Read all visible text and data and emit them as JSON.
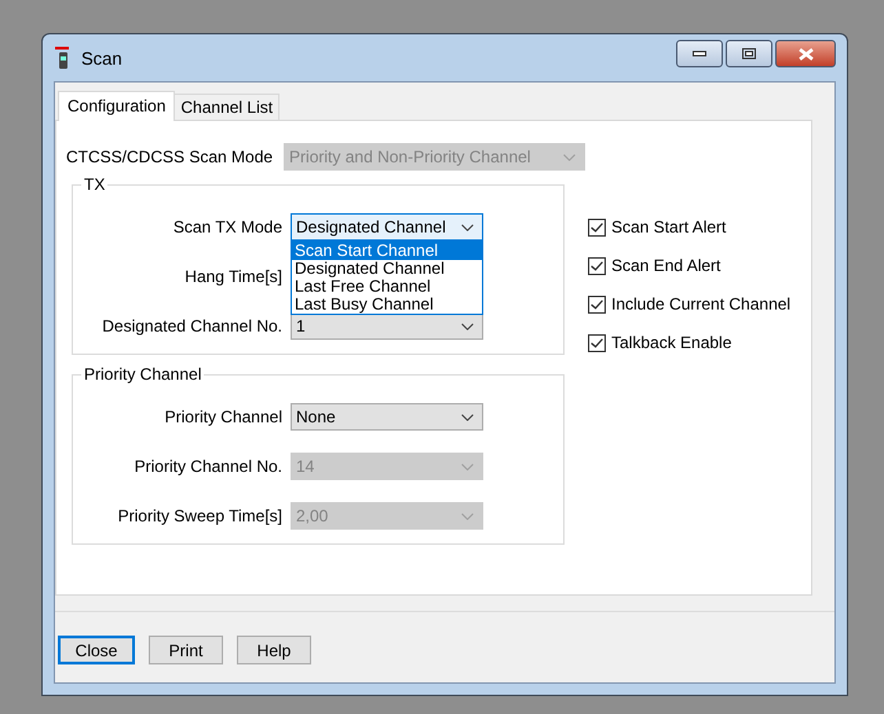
{
  "window": {
    "title": "Scan"
  },
  "tabs": [
    {
      "label": "Configuration",
      "selected": true
    },
    {
      "label": "Channel List",
      "selected": false
    }
  ],
  "scan_mode": {
    "label": "CTCSS/CDCSS Scan Mode",
    "value": "Priority and Non-Priority Channel",
    "disabled": true
  },
  "groups": [
    {
      "title": "TX",
      "fields": [
        {
          "label": "Scan TX Mode",
          "value": "Designated Channel",
          "disabled": false,
          "focused": true,
          "options": [
            {
              "label": "Scan Start Channel",
              "highlighted": true
            },
            {
              "label": "Designated Channel",
              "highlighted": false
            },
            {
              "label": "Last Free Channel",
              "highlighted": false
            },
            {
              "label": "Last Busy Channel",
              "highlighted": false
            }
          ]
        },
        {
          "label": "Hang Time[s]"
        },
        {
          "label": "Designated Channel No.",
          "value": "1",
          "disabled": false,
          "focused": false
        }
      ]
    },
    {
      "title": "Priority Channel",
      "fields": [
        {
          "label": "Priority Channel",
          "value": "None",
          "disabled": false,
          "focused": false
        },
        {
          "label": "Priority Channel No.",
          "value": "14",
          "disabled": true,
          "focused": false
        },
        {
          "label": "Priority Sweep Time[s]",
          "value": "2,00",
          "disabled": true,
          "focused": false
        }
      ]
    }
  ],
  "checkboxes": [
    {
      "label": "Scan Start Alert",
      "checked": true
    },
    {
      "label": "Scan End Alert",
      "checked": true
    },
    {
      "label": "Include Current Channel",
      "checked": true
    },
    {
      "label": "Talkback Enable",
      "checked": true
    }
  ],
  "buttons": [
    {
      "label": "Close",
      "default": true
    },
    {
      "label": "Print",
      "default": false
    },
    {
      "label": "Help",
      "default": false
    }
  ]
}
